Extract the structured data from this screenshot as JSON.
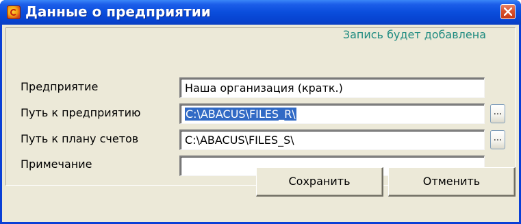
{
  "window": {
    "title": "Данные о предприятии",
    "app_icon": "abacus-app-icon",
    "close_icon": "close-icon"
  },
  "status": {
    "text": "Запись будет добавлена"
  },
  "form": {
    "fields": [
      {
        "label": "Предприятие",
        "value": "Наша организация (кратк.)",
        "has_browse": false
      },
      {
        "label": "Путь к предприятию",
        "value": "C:\\ABACUS\\FILES_R\\",
        "selected": true,
        "has_browse": true,
        "browse_label": "..."
      },
      {
        "label": "Путь к плану счетов",
        "value": "C:\\ABACUS\\FILES_S\\",
        "has_browse": true,
        "browse_label": "..."
      },
      {
        "label": "Примечание",
        "value": "",
        "has_browse": false
      }
    ]
  },
  "buttons": {
    "save_label": "Сохранить",
    "cancel_label": "Отменить"
  },
  "colors": {
    "titlebar": "#0a4ddc",
    "status_text": "#1f8b80",
    "selection": "#316ac5",
    "dialog_face": "#ece9d8"
  }
}
